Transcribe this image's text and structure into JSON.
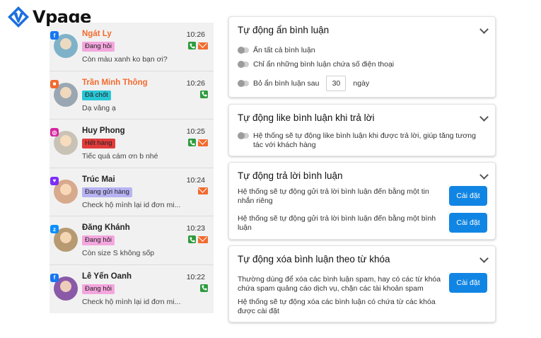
{
  "brand": {
    "name": "Vpage"
  },
  "conversations": [
    {
      "name": "Ngát Ly",
      "highlight": true,
      "channel": "facebook",
      "tag": "Đang hỏi",
      "tag_color": "#f4a6de",
      "message": "Còn màu xanh ko bạn ơi?",
      "time": "10:26",
      "phone": true,
      "mail": true,
      "avatar_color": "#7fb2c9"
    },
    {
      "name": "Trần Minh Thông",
      "highlight": true,
      "channel": "shop",
      "tag": "Đã chốt",
      "tag_color": "#29c6d4",
      "message": "Dạ vâng ạ",
      "time": "10:26",
      "phone": true,
      "mail": false,
      "avatar_color": "#9aa7b3"
    },
    {
      "name": "Huy Phong",
      "highlight": false,
      "channel": "instagram",
      "tag": "Hết hàng",
      "tag_color": "#e23b3b",
      "message": "Tiếc quá cám ơn b nhé",
      "time": "10:25",
      "phone": true,
      "mail": true,
      "avatar_color": "#c9c3b6"
    },
    {
      "name": "Trúc Mai",
      "highlight": false,
      "channel": "lazada",
      "tag": "Đang gửi hàng",
      "tag_color": "#b7b3f3",
      "message": "Check hộ mình lại id đơn mi...",
      "time": "10:24",
      "phone": false,
      "mail": true,
      "avatar_color": "#d7a98d"
    },
    {
      "name": "Đăng Khánh",
      "highlight": false,
      "channel": "zalo",
      "tag": "Đang hỏi",
      "tag_color": "#f4a6de",
      "message": "Còn size S không sốp",
      "time": "10:23",
      "phone": true,
      "mail": true,
      "avatar_color": "#b79a72"
    },
    {
      "name": "Lê Yến Oanh",
      "highlight": false,
      "channel": "facebook",
      "tag": "Đang hỏi",
      "tag_color": "#f4a6de",
      "message": "Check hộ mình lại id đơn mi...",
      "time": "10:22",
      "phone": true,
      "mail": false,
      "avatar_color": "#8a5aa8"
    }
  ],
  "cards": {
    "auto_hide": {
      "title": "Tự động ẩn bình luận",
      "opt_hide_all": "Ẩn tất cả bình luận",
      "opt_hide_phone": "Chỉ ẩn những bình luận chứa số điện thoại",
      "opt_unhide_prefix": "Bỏ ẩn bình luận sau",
      "opt_unhide_value": "30",
      "opt_unhide_unit": "ngày"
    },
    "auto_like": {
      "title": "Tự động like bình luận khi trả lời",
      "opt_text": "Hệ thống sẽ tự động like bình luận khi được trả lời, giúp tăng tương tác với khách hàng"
    },
    "auto_reply": {
      "title": "Tự động trả lời bình luận",
      "row1_text": "Hệ thống sẽ tự động gửi trả lời bình luận đến bằng một tin nhắn riêng",
      "row1_button": "Cài đặt",
      "row2_text": "Hệ thống sẽ tự động gửi trả lời bình luận đến bằng một bình luận",
      "row2_button": "Cài đặt"
    },
    "auto_delete": {
      "title": "Tự động xóa bình luận theo từ khóa",
      "row1_text": "Thường dùng để xóa các bình luận spam, hay có các từ khóa chứa spam quảng cáo dịch vụ, chặn các tài khoản spam",
      "row1_button": "Cài đặt",
      "row2_text": "Hệ thống sẽ tự động xóa các bình luận có chứa từ các khóa được cài đặt"
    }
  }
}
